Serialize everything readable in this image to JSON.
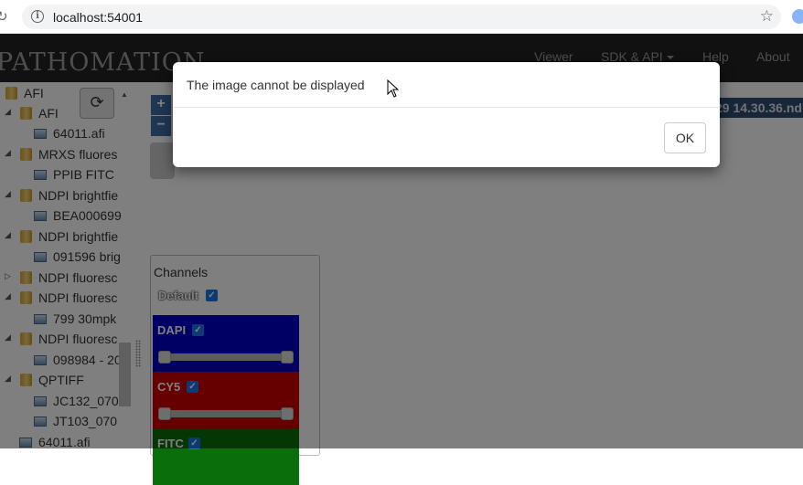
{
  "browser": {
    "url": "localhost:54001"
  },
  "navbar": {
    "brand": "PATHOMATION",
    "items": [
      {
        "label": "Viewer"
      },
      {
        "label": "SDK & API"
      },
      {
        "label": "Help"
      },
      {
        "label": "About"
      }
    ]
  },
  "sidebar": {
    "tree": [
      {
        "label": "AFI",
        "kind": "folder"
      },
      {
        "label": "AFI",
        "kind": "folder"
      },
      {
        "label": "64011.afi",
        "kind": "file"
      },
      {
        "label": "MRXS fluores",
        "kind": "folder"
      },
      {
        "label": "PPIB FITC",
        "kind": "file"
      },
      {
        "label": "NDPI brightfie",
        "kind": "folder"
      },
      {
        "label": "BEA000699",
        "kind": "file"
      },
      {
        "label": "NDPI brightfie",
        "kind": "folder"
      },
      {
        "label": "091596 brig",
        "kind": "file"
      },
      {
        "label": "NDPI fluoresc",
        "kind": "folder"
      },
      {
        "label": "NDPI fluoresc",
        "kind": "folder"
      },
      {
        "label": "799 30mpk",
        "kind": "file"
      },
      {
        "label": "NDPI fluoresc",
        "kind": "folder"
      },
      {
        "label": "098984 - 20",
        "kind": "file"
      },
      {
        "label": "QPTIFF",
        "kind": "folder"
      },
      {
        "label": "JC132_070",
        "kind": "file"
      },
      {
        "label": "JT103_070",
        "kind": "file"
      },
      {
        "label": "64011.afi",
        "kind": "file"
      }
    ]
  },
  "viewer": {
    "zoom_in": "+",
    "zoom_out": "−",
    "slide_title": "29 14.30.36.nd",
    "channels": {
      "title": "Channels",
      "default_label": "Default",
      "items": [
        {
          "name": "DAPI",
          "color": "#0000c8"
        },
        {
          "name": "CY5",
          "color": "#cc0000"
        },
        {
          "name": "FITC",
          "color": "#0a6e0a"
        }
      ]
    }
  },
  "dialog": {
    "message": "The image cannot be displayed",
    "ok_label": "OK"
  }
}
